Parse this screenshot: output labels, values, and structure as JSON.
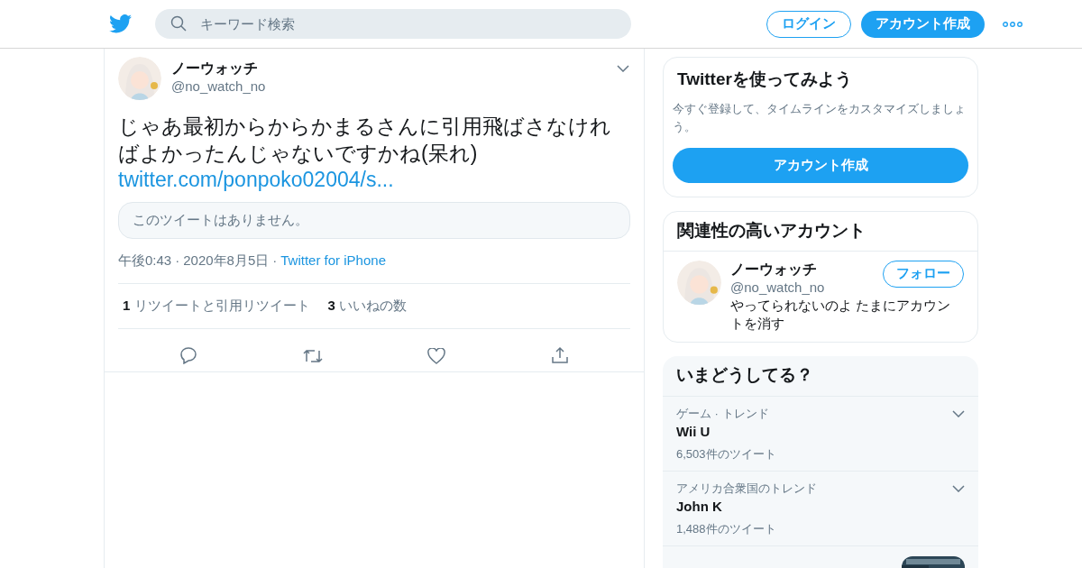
{
  "header": {
    "search": {
      "placeholder": "キーワード検索"
    },
    "login": "ログイン",
    "signup": "アカウント作成"
  },
  "tweet": {
    "author": {
      "name": "ノーウォッチ",
      "handle": "@no_watch_no"
    },
    "text": "じゃあ最初からからかまるさんに引用飛ばさなければよかったんじゃないですかね(呆れ)",
    "link": "twitter.com/ponpoko02004/s...",
    "quote_unavailable": "このツイートはありません。",
    "time": "午後0:43",
    "date": "2020年8月5日",
    "source": "Twitter for iPhone",
    "separator": "·",
    "stats": [
      {
        "count": "1",
        "label": "リツイートと引用リツイート"
      },
      {
        "count": "3",
        "label": "いいねの数"
      }
    ]
  },
  "signup_card": {
    "title": "Twitterを使ってみよう",
    "text": "今すぐ登録して、タイムラインをカスタマイズしましょう。",
    "button": "アカウント作成"
  },
  "related": {
    "title": "関連性の高いアカウント",
    "accounts": [
      {
        "name": "ノーウォッチ",
        "handle": "@no_watch_no",
        "bio": "やってられないのよ たまにアカウントを消す",
        "follow": "フォロー"
      }
    ]
  },
  "trends": {
    "title": "いまどうしてる？",
    "items": [
      {
        "kind": "trend",
        "context": "ゲーム · トレンド",
        "name": "Wii U",
        "count": "6,503件のツイート"
      },
      {
        "kind": "trend",
        "context": "アメリカ合衆国のトレンド",
        "name": "John K",
        "count": "1,488件のツイート"
      },
      {
        "kind": "picture"
      }
    ]
  }
}
